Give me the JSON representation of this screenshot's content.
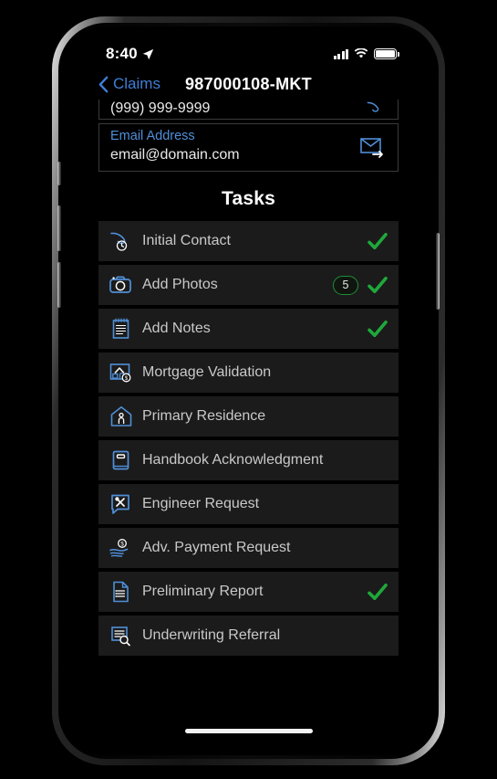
{
  "colors": {
    "accent_blue": "#4f8fd8",
    "link_blue": "#3f7fd6",
    "check_green": "#1fa83a",
    "badge_border": "#1f8f37",
    "row_bg": "#1b1b1b",
    "screen_bg": "#000000",
    "label_gray": "#c9c9c9"
  },
  "status_bar": {
    "time": "8:40",
    "location_icon": "location-arrow-icon",
    "signal_icon": "cellular-signal-icon",
    "wifi_icon": "wifi-icon",
    "battery_icon": "battery-full-icon"
  },
  "nav": {
    "back_icon": "chevron-left-icon",
    "back_label": "Claims",
    "title": "987000108-MKT"
  },
  "fields": [
    {
      "name": "phone-field",
      "label": "",
      "value": "(999) 999-9999",
      "action_icon": "phone-call-icon",
      "clipped": true
    },
    {
      "name": "email-field",
      "label": "Email Address",
      "value": "email@domain.com",
      "action_icon": "envelope-send-icon",
      "clipped": false
    }
  ],
  "tasks_section": {
    "title": "Tasks",
    "items": [
      {
        "label": "Initial Contact",
        "icon": "phone-clock-icon",
        "completed": true,
        "badge": null
      },
      {
        "label": "Add Photos",
        "icon": "camera-icon",
        "completed": true,
        "badge": "5"
      },
      {
        "label": "Add Notes",
        "icon": "notepad-icon",
        "completed": true,
        "badge": null
      },
      {
        "label": "Mortgage Validation",
        "icon": "house-money-icon",
        "completed": false,
        "badge": null
      },
      {
        "label": "Primary Residence",
        "icon": "house-person-icon",
        "completed": false,
        "badge": null
      },
      {
        "label": "Handbook Acknowledgment",
        "icon": "book-icon",
        "completed": false,
        "badge": null
      },
      {
        "label": "Engineer Request",
        "icon": "engineer-chat-icon",
        "completed": false,
        "badge": null
      },
      {
        "label": "Adv. Payment Request",
        "icon": "hand-coin-icon",
        "completed": false,
        "badge": null
      },
      {
        "label": "Preliminary Report",
        "icon": "document-list-icon",
        "completed": true,
        "badge": null
      },
      {
        "label": "Underwriting Referral",
        "icon": "document-search-icon",
        "completed": false,
        "badge": null
      }
    ]
  },
  "home_indicator": "home-indicator"
}
